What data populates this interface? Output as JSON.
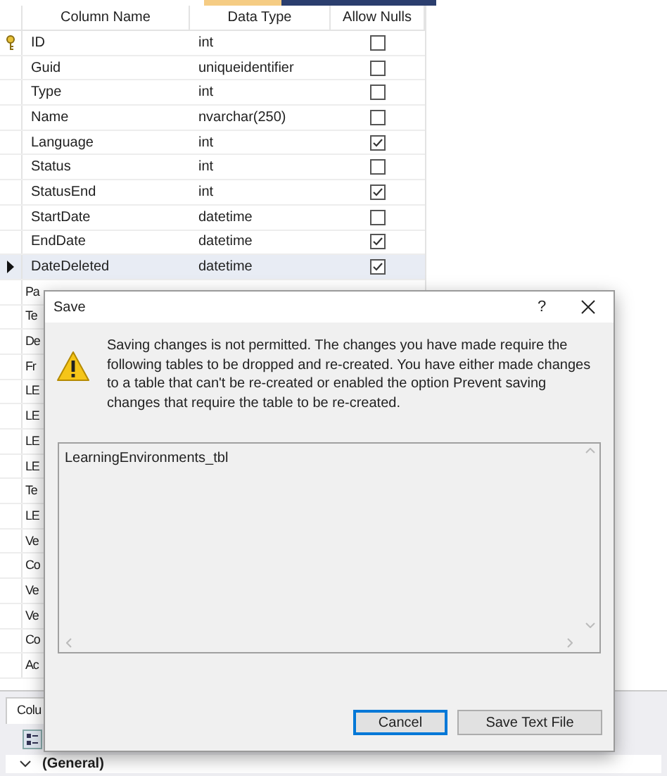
{
  "table": {
    "columns": [
      "Column Name",
      "Data Type",
      "Allow Nulls"
    ],
    "rows": [
      {
        "name": "ID",
        "type": "int",
        "allow_nulls": false,
        "primary_key": true,
        "selected": false
      },
      {
        "name": "Guid",
        "type": "uniqueidentifier",
        "allow_nulls": false,
        "primary_key": false,
        "selected": false
      },
      {
        "name": "Type",
        "type": "int",
        "allow_nulls": false,
        "primary_key": false,
        "selected": false
      },
      {
        "name": "Name",
        "type": "nvarchar(250)",
        "allow_nulls": false,
        "primary_key": false,
        "selected": false
      },
      {
        "name": "Language",
        "type": "int",
        "allow_nulls": true,
        "primary_key": false,
        "selected": false
      },
      {
        "name": "Status",
        "type": "int",
        "allow_nulls": false,
        "primary_key": false,
        "selected": false
      },
      {
        "name": "StatusEnd",
        "type": "int",
        "allow_nulls": true,
        "primary_key": false,
        "selected": false
      },
      {
        "name": "StartDate",
        "type": "datetime",
        "allow_nulls": false,
        "primary_key": false,
        "selected": false
      },
      {
        "name": "EndDate",
        "type": "datetime",
        "allow_nulls": true,
        "primary_key": false,
        "selected": false
      },
      {
        "name": "DateDeleted",
        "type": "datetime",
        "allow_nulls": true,
        "primary_key": false,
        "selected": true
      },
      {
        "name": "Pa"
      },
      {
        "name": "Te"
      },
      {
        "name": "De"
      },
      {
        "name": "Fr"
      },
      {
        "name": "LE"
      },
      {
        "name": "LE"
      },
      {
        "name": "LE"
      },
      {
        "name": "LE"
      },
      {
        "name": "Te"
      },
      {
        "name": "LE"
      },
      {
        "name": "Ve"
      },
      {
        "name": "Co"
      },
      {
        "name": "Ve"
      },
      {
        "name": "Ve"
      },
      {
        "name": "Co"
      },
      {
        "name": "Ac"
      }
    ]
  },
  "properties_panel": {
    "tab": "Colu",
    "section": "(General)"
  },
  "dialog": {
    "title": "Save",
    "help": "?",
    "message": "Saving changes is not permitted. The changes you have made require the following tables to be dropped and re-created. You have either made changes to a table that can't be re-created or enabled the option Prevent saving changes that require the table to be re-created.",
    "tables": [
      "LearningEnvironments_tbl"
    ],
    "buttons": [
      {
        "label": "Cancel",
        "default": true
      },
      {
        "label": "Save Text File",
        "default": false
      }
    ]
  }
}
